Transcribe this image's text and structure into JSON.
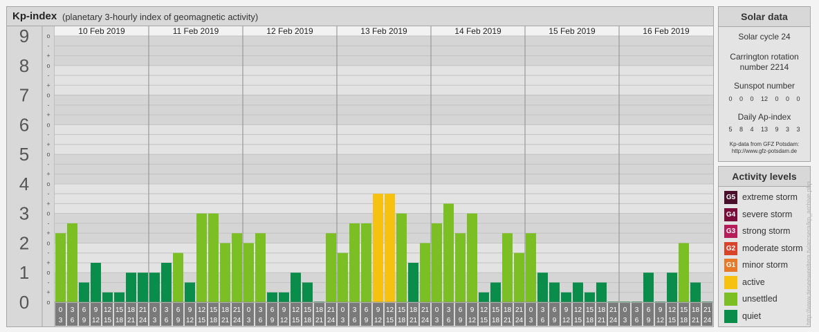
{
  "header": {
    "title": "Kp-index",
    "subtitle": "(planetary 3-hourly index of geomagnetic activity)"
  },
  "chart_data": {
    "type": "bar",
    "title": "Kp-index",
    "subtitle": "(planetary 3-hourly index of geomagnetic activity)",
    "ylim": [
      0,
      9
    ],
    "y_ticks": [
      "0",
      "1",
      "2",
      "3",
      "4",
      "5",
      "6",
      "7",
      "8",
      "9"
    ],
    "minor_ticks": [
      "o",
      "+",
      "-",
      "o",
      "+",
      "-",
      "o",
      "+",
      "-",
      "o",
      "+",
      "-",
      "o",
      "+",
      "-",
      "o",
      "+",
      "-",
      "o",
      "+",
      "-",
      "o",
      "+",
      "-",
      "o",
      "+",
      "-",
      "o"
    ],
    "days": [
      "10 Feb 2019",
      "11 Feb 2019",
      "12 Feb 2019",
      "13 Feb 2019",
      "14 Feb 2019",
      "15 Feb 2019",
      "16 Feb 2019"
    ],
    "hour_ticks": [
      [
        "0",
        "3"
      ],
      [
        "3",
        "6"
      ],
      [
        "6",
        "9"
      ],
      [
        "9",
        "12"
      ],
      [
        "12",
        "15"
      ],
      [
        "15",
        "18"
      ],
      [
        "18",
        "21"
      ],
      [
        "21",
        "24"
      ]
    ],
    "values": [
      [
        2.333,
        2.667,
        0.667,
        1.333,
        0.333,
        0.333,
        1.0,
        1.0
      ],
      [
        1.0,
        1.333,
        1.667,
        0.667,
        3.0,
        3.0,
        2.0,
        2.333
      ],
      [
        2.0,
        2.333,
        0.333,
        0.333,
        1.0,
        0.667,
        0.0,
        2.333
      ],
      [
        1.667,
        2.667,
        2.667,
        3.667,
        3.667,
        3.0,
        1.333,
        2.0
      ],
      [
        2.667,
        3.333,
        2.333,
        3.0,
        0.333,
        0.667,
        2.333,
        1.667
      ],
      [
        2.333,
        1.0,
        0.667,
        0.333,
        0.667,
        0.333,
        0.667,
        0.0
      ],
      [
        0.0,
        0.0,
        1.0,
        0.0,
        1.0,
        2.0,
        0.667,
        0.0
      ]
    ],
    "colors": {
      "quiet": "#0a8c4a",
      "unsettled": "#7bbf25",
      "active": "#f6c10f"
    }
  },
  "solar": {
    "title": "Solar data",
    "cycle": "Solar cycle 24",
    "carrington_line1": "Carrington rotation",
    "carrington_line2": "number 2214",
    "sunspot_label": "Sunspot number",
    "sunspot_values": "0 0 0 12 0 0 0",
    "ap_label": "Daily Ap-index",
    "ap_values": "5 8 4 13 9 3 3",
    "source_line1": "Kp-data from GFZ Potsdam:",
    "source_line2": "http://www.gfz-potsdam.de"
  },
  "levels": {
    "title": "Activity levels",
    "items": [
      {
        "code": "G5",
        "label": "extreme storm",
        "color": "#4a0f2b"
      },
      {
        "code": "G4",
        "label": "severe storm",
        "color": "#7a0c3a"
      },
      {
        "code": "G3",
        "label": "strong storm",
        "color": "#b71c5a"
      },
      {
        "code": "G2",
        "label": "moderate storm",
        "color": "#d9432a"
      },
      {
        "code": "G1",
        "label": "minor storm",
        "color": "#e8782a"
      },
      {
        "code": "",
        "label": "active",
        "color": "#f6c10f"
      },
      {
        "code": "",
        "label": "unsettled",
        "color": "#7bbf25"
      },
      {
        "code": "",
        "label": "quiet",
        "color": "#0a8c4a"
      }
    ]
  },
  "watermark": "http://www.tieseeweeltera.tv/arcsera/kp_archive.php"
}
